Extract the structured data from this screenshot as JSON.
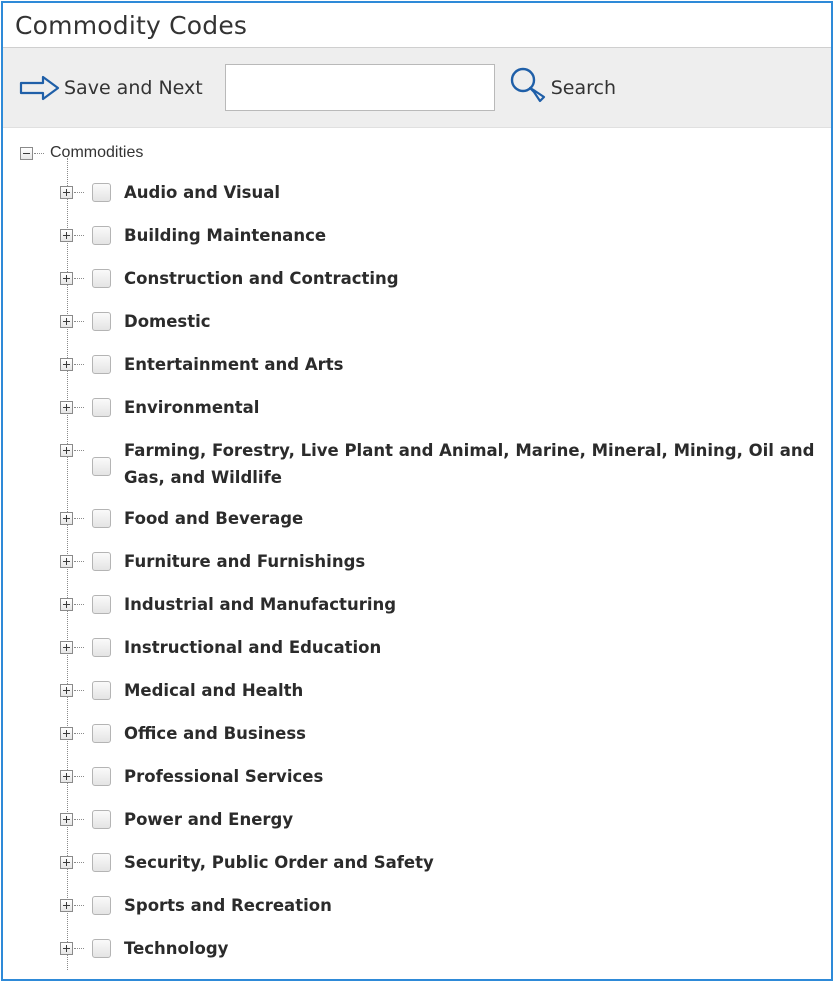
{
  "panel": {
    "title": "Commodity Codes"
  },
  "toolbar": {
    "save_next_label": "Save and Next",
    "search_value": "",
    "search_placeholder": "",
    "search_label": "Search"
  },
  "tree": {
    "root_label": "Commodities",
    "items": [
      {
        "label": "Audio and Visual"
      },
      {
        "label": "Building Maintenance"
      },
      {
        "label": "Construction and Contracting"
      },
      {
        "label": "Domestic"
      },
      {
        "label": "Entertainment and Arts"
      },
      {
        "label": "Environmental"
      },
      {
        "label": "Farming, Forestry, Live Plant and Animal, Marine, Mineral, Mining, Oil and Gas, and Wildlife"
      },
      {
        "label": "Food and Beverage"
      },
      {
        "label": "Furniture and Furnishings"
      },
      {
        "label": "Industrial and Manufacturing"
      },
      {
        "label": "Instructional and Education"
      },
      {
        "label": "Medical and Health"
      },
      {
        "label": "Office and Business"
      },
      {
        "label": "Professional Services"
      },
      {
        "label": "Power and Energy"
      },
      {
        "label": "Security, Public Order and Safety"
      },
      {
        "label": "Sports and Recreation"
      },
      {
        "label": "Technology"
      }
    ]
  },
  "colors": {
    "frame_border": "#2e8ad8",
    "toolbar_bg": "#eeeeee",
    "icon_blue": "#1f5fa8"
  },
  "icons": {
    "save_next": "arrow-right-outline-icon",
    "search": "magnifier-icon",
    "expand": "plus-box-icon",
    "collapse": "minus-box-icon"
  }
}
